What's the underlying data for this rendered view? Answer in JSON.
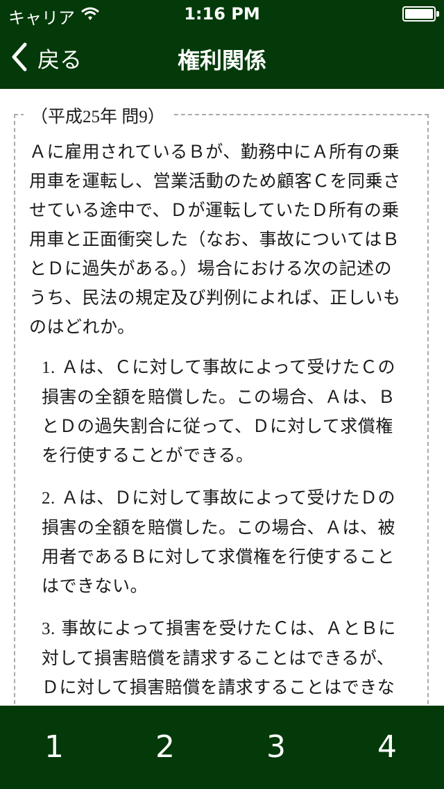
{
  "status_bar": {
    "carrier": "キャリア",
    "time": "1:16 PM",
    "wifi_icon": "wifi-icon",
    "battery_icon": "battery-icon"
  },
  "nav": {
    "back_label": "戻る",
    "back_icon": "chevron-left-icon",
    "title": "権利関係"
  },
  "question": {
    "source": "（平成25年 問9）",
    "text": "Ａに雇用されているＢが、勤務中にＡ所有の乗用車を運転し、営業活動のため顧客Ｃを同乗させている途中で、Ｄが運転していたＤ所有の乗用車と正面衝突した（なお、事故についてはＢとＤに過失がある。）場合における次の記述のうち、民法の規定及び判例によれば、正しいものはどれか。",
    "choices": [
      {
        "number": "1.",
        "text": "Ａは、Ｃに対して事故によって受けたＣの損害の全額を賠償した。この場合、Ａは、ＢとＤの過失割合に従って、Ｄに対して求償権を行使することができる。"
      },
      {
        "number": "2.",
        "text": "Ａは、Ｄに対して事故によって受けたＤの損害の全額を賠償した。この場合、Ａは、被用者であるＢに対して求償権を行使することはできない。"
      },
      {
        "number": "3.",
        "text": "事故によって損害を受けたＣは、ＡとＢに対して損害賠償を請求することはできるが、Ｄに対して損害賠償を請求することはできな"
      }
    ]
  },
  "answer_bar": {
    "buttons": [
      "1",
      "2",
      "3",
      "4"
    ]
  },
  "colors": {
    "bar_background": "#043a09",
    "bar_text": "#ffffff",
    "frame_border": "#aaaaaa"
  }
}
